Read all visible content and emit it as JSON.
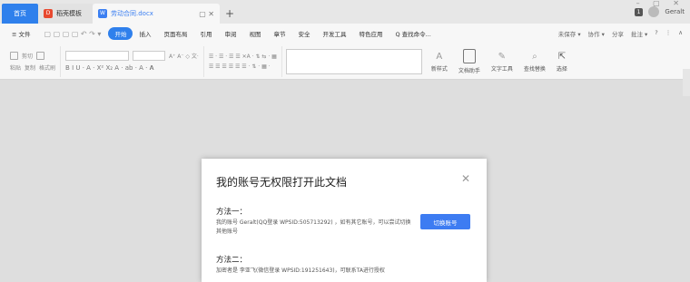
{
  "tabs": {
    "home": "首页",
    "template": "稻壳模板",
    "doc": "劳动合同.docx",
    "doc_ctl": "▢ ✕",
    "plus": "+"
  },
  "window": {
    "badge": "1",
    "user": "Geralt",
    "controls": "–  ▢  ✕"
  },
  "menu": {
    "file": "≡ 文件",
    "items": [
      "开始",
      "插入",
      "页面布局",
      "引用",
      "审阅",
      "视图",
      "章节",
      "安全",
      "开发工具",
      "特色应用",
      "Q 查找命令..."
    ],
    "right": [
      "未保存 ▾",
      "协作 ▾",
      "分享",
      "批注 ▾",
      "?",
      "⋮",
      "∧"
    ]
  },
  "toolbar": {
    "paste": "粘贴",
    "cut": "剪切",
    "copy": "复制",
    "format_painter": "格式刷",
    "styles": "新样式",
    "text_assistant": "文档助手",
    "text_tools": "文字工具",
    "find_replace": "查找替换",
    "select": "选择",
    "format_row": "B  I  U · A · X² X₂  A · ab · A · 𝐀",
    "para_row": "☰ ☰ ☰ ☰ ☰ ☰ · ⇅ · ▦ ·",
    "font_ops": "A⁺ A⁻ ◇ 文·",
    "list_ops": "☰ · ☰ · ☰ ☰ ✕A · ⇅ ⇆ · ▦"
  },
  "dialog": {
    "title": "我的账号无权限打开此文档",
    "close": "✕",
    "method1_title": "方法一：",
    "method1_text": "我的账号 Geralt(QQ登录 WPSID:505713292) ，如有其它账号，可以尝试切换其他账号",
    "switch_button": "切换账号",
    "method2_title": "方法二：",
    "method2_text": "加密者是 李亚飞(微信登录 WPSID:191251643)，可联系TA进行授权"
  }
}
